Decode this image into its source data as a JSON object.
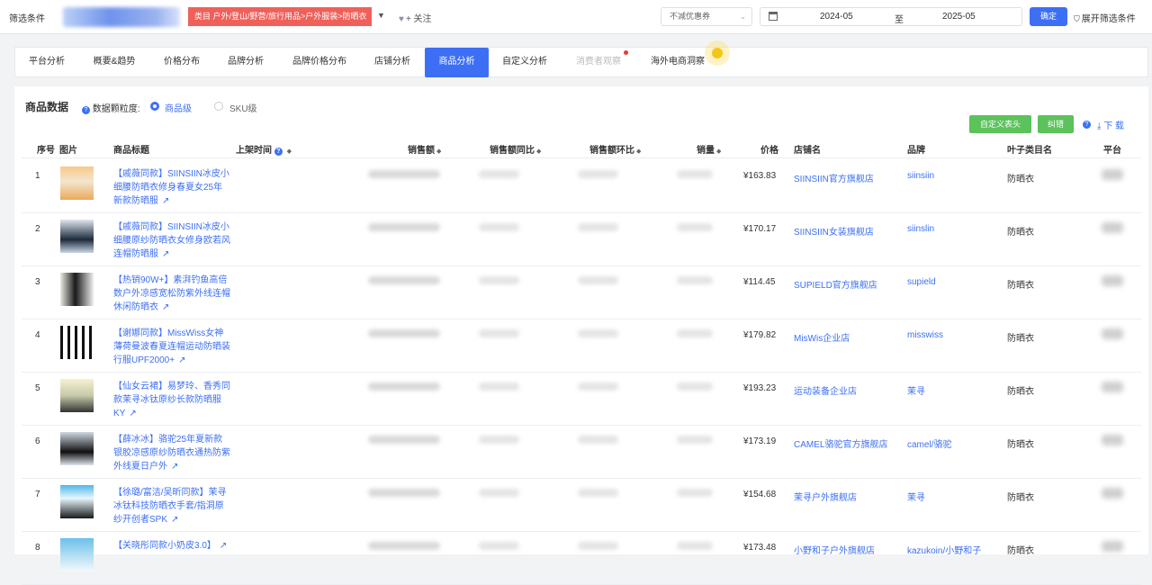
{
  "filter_bar": {
    "label": "筛选条件",
    "category_tag": "类目 户外/登山/野营/旅行用品>户外服装>防晒衣",
    "follow": "+ 关注",
    "coupon_select": "不减优惠券",
    "date_start": "2024-05",
    "date_sep": "至",
    "date_end": "2025-05",
    "ok": "确定",
    "expand": "展开筛选条件"
  },
  "tabs": [
    "平台分析",
    "概要&趋势",
    "价格分布",
    "品牌分析",
    "品牌价格分布",
    "店铺分析",
    "商品分析",
    "自定义分析",
    "消费者观察",
    "海外电商洞察"
  ],
  "active_tab": "商品分析",
  "panel": {
    "title": "商品数据",
    "granularity_label": "数据颗粒度:",
    "option_product": "商品级",
    "option_sku": "SKU级",
    "custom_header_btn": "自定义表头",
    "correct_btn": "纠错",
    "download": "下 载"
  },
  "table": {
    "headers": {
      "seq": "序号",
      "img": "图片",
      "title": "商品标题",
      "launch": "上架时间",
      "sales": "销售额",
      "yoy": "销售额同比",
      "mom": "销售额环比",
      "qty": "销量",
      "price": "价格",
      "shop": "店铺名",
      "brand": "品牌",
      "leaf": "叶子类目名",
      "platform": "平台"
    },
    "rows": [
      {
        "seq": "1",
        "title": "【戚薇同款】SIINSIIN冰皮小细腰防晒衣修身春夏女25年新款防晒服",
        "price": "¥163.83",
        "shop": "SIINSIIN官方旗舰店",
        "brand": "siinsiin",
        "leaf": "防晒衣"
      },
      {
        "seq": "2",
        "title": "【戚薇同款】SIINSIIN冰皮小细腰原纱防晒衣女修身欧若风连帽防晒服",
        "price": "¥170.17",
        "shop": "SIINSIIN女装旗舰店",
        "brand": "siinslin",
        "leaf": "防晒衣"
      },
      {
        "seq": "3",
        "title": "【热销90W+】素湃钓鱼高倍数户外凉感宽松防紫外线连帽休闲防晒衣",
        "price": "¥114.45",
        "shop": "SUPIELD官方旗舰店",
        "brand": "supield",
        "leaf": "防晒衣"
      },
      {
        "seq": "4",
        "title": "【谢娜同款】MissWiss女神薄荷曼波春夏连帽运动防晒装行服UPF2000+",
        "price": "¥179.82",
        "shop": "MisWis企业店",
        "brand": "misswiss",
        "leaf": "防晒衣"
      },
      {
        "seq": "5",
        "title": "【仙女云裙】易梦玲、香秀同款茉寻冰钛原纱长款防晒服KY",
        "price": "¥193.23",
        "shop": "运动装备企业店",
        "brand": "茉寻",
        "leaf": "防晒衣"
      },
      {
        "seq": "6",
        "title": "【薛冰冰】骆驼25年夏新款银胶凉感原纱防晒衣通热防紫外线夏日户外",
        "price": "¥173.19",
        "shop": "CAMEL骆驼官方旗舰店",
        "brand": "camel/骆驼",
        "leaf": "防晒衣"
      },
      {
        "seq": "7",
        "title": "【徐璐/富洁/吴昕同款】茉寻冰钛科技防晒衣手套/指洞原纱开创者SPK",
        "price": "¥154.68",
        "shop": "茉寻户外旗舰店",
        "brand": "茉寻",
        "leaf": "防晒衣"
      },
      {
        "seq": "8",
        "title": "【关晓彤同款小奶皮3.0】",
        "price": "¥173.48",
        "shop": "小野和子户外旗舰店",
        "brand": "kazukoin/小野和子",
        "leaf": "防晒衣"
      }
    ]
  },
  "colors": {
    "accent": "#3d6ff5",
    "tag_red": "#f0605a",
    "green": "#5cc25c"
  },
  "icons": [
    "heart-icon",
    "calendar-icon",
    "filter-icon",
    "question-icon",
    "download-icon",
    "external-link-icon",
    "sort-icon",
    "chevron-down-icon"
  ]
}
